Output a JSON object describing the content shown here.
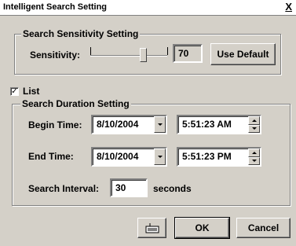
{
  "window": {
    "title": "Intelligent Search Setting",
    "close_label": "X"
  },
  "sensitivity_group": {
    "label": "Search Sensitivity Setting",
    "sensitivity_label": "Sensitivity:",
    "value": "70",
    "use_default_label": "Use Default"
  },
  "list_checkbox": {
    "label": "List",
    "checked": true,
    "mark": "✓"
  },
  "duration_group": {
    "label": "Search Duration Setting",
    "begin_label": "Begin Time:",
    "begin_date": "8/10/2004",
    "begin_time": "5:51:23 AM",
    "end_label": "End Time:",
    "end_date": "8/10/2004",
    "end_time": "5:51:23 PM",
    "interval_label": "Search Interval:",
    "interval_value": "30",
    "interval_unit": "seconds"
  },
  "footer": {
    "ok_label": "OK",
    "cancel_label": "Cancel",
    "keyboard_icon": "keyboard-icon"
  }
}
